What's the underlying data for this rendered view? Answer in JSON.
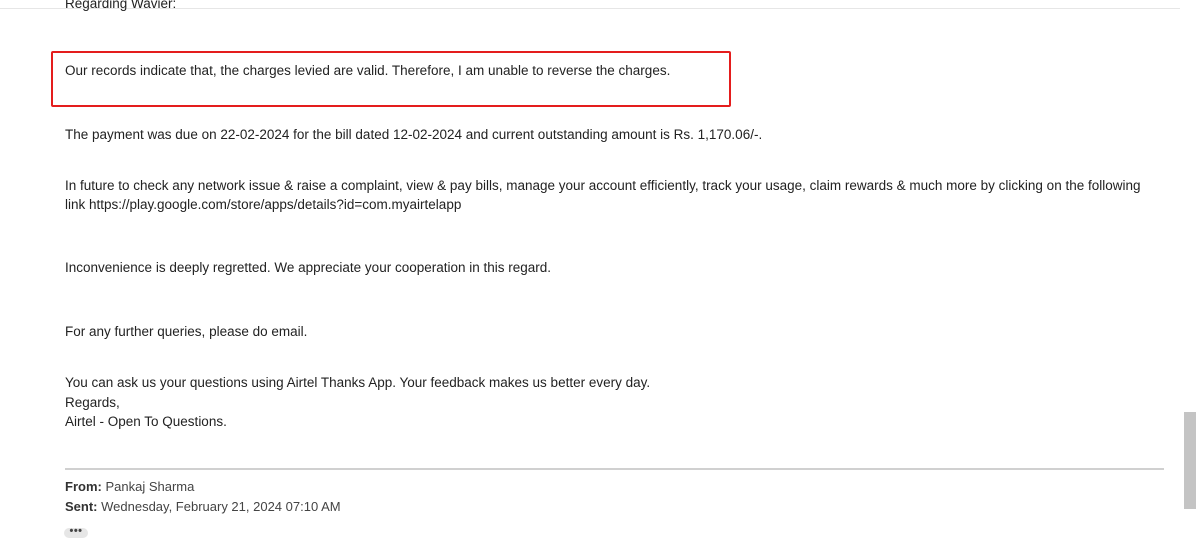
{
  "email": {
    "cut_off_line": "Regarding Wavier:",
    "paragraphs": {
      "highlighted": "Our records indicate that, the charges levied are valid. Therefore, I am unable to reverse the charges.",
      "payment": "The payment was due on 22-02-2024 for the bill dated 12-02-2024 and current outstanding amount is Rs. 1,170.06/-.",
      "future_line1": "In future to check any network issue & raise a complaint, view & pay bills, manage your account efficiently, track your usage, claim rewards & much more by clicking on the following",
      "future_line2": "link https://play.google.com/store/apps/details?id=com.myairtelapp",
      "inconvenience": "Inconvenience is deeply regretted. We appreciate your cooperation in this regard.",
      "queries": "For any further queries, please do email.",
      "ask": "You can ask us your questions using Airtel Thanks App. Your feedback makes us better every day.",
      "regards": "Regards,",
      "signature": "Airtel - Open To Questions."
    },
    "previous_message": {
      "from_label": "From:",
      "from_value": "Pankaj Sharma",
      "sent_label": "Sent:",
      "sent_value": "Wednesday, February 21, 2024 07:10 AM"
    },
    "show_more_label": "•••"
  },
  "colors": {
    "highlight_border": "#e41d1d",
    "divider": "#d0d0d0",
    "scroll_thumb": "#c4c4c4"
  },
  "icons": {
    "show_more": "ellipsis-icon"
  }
}
